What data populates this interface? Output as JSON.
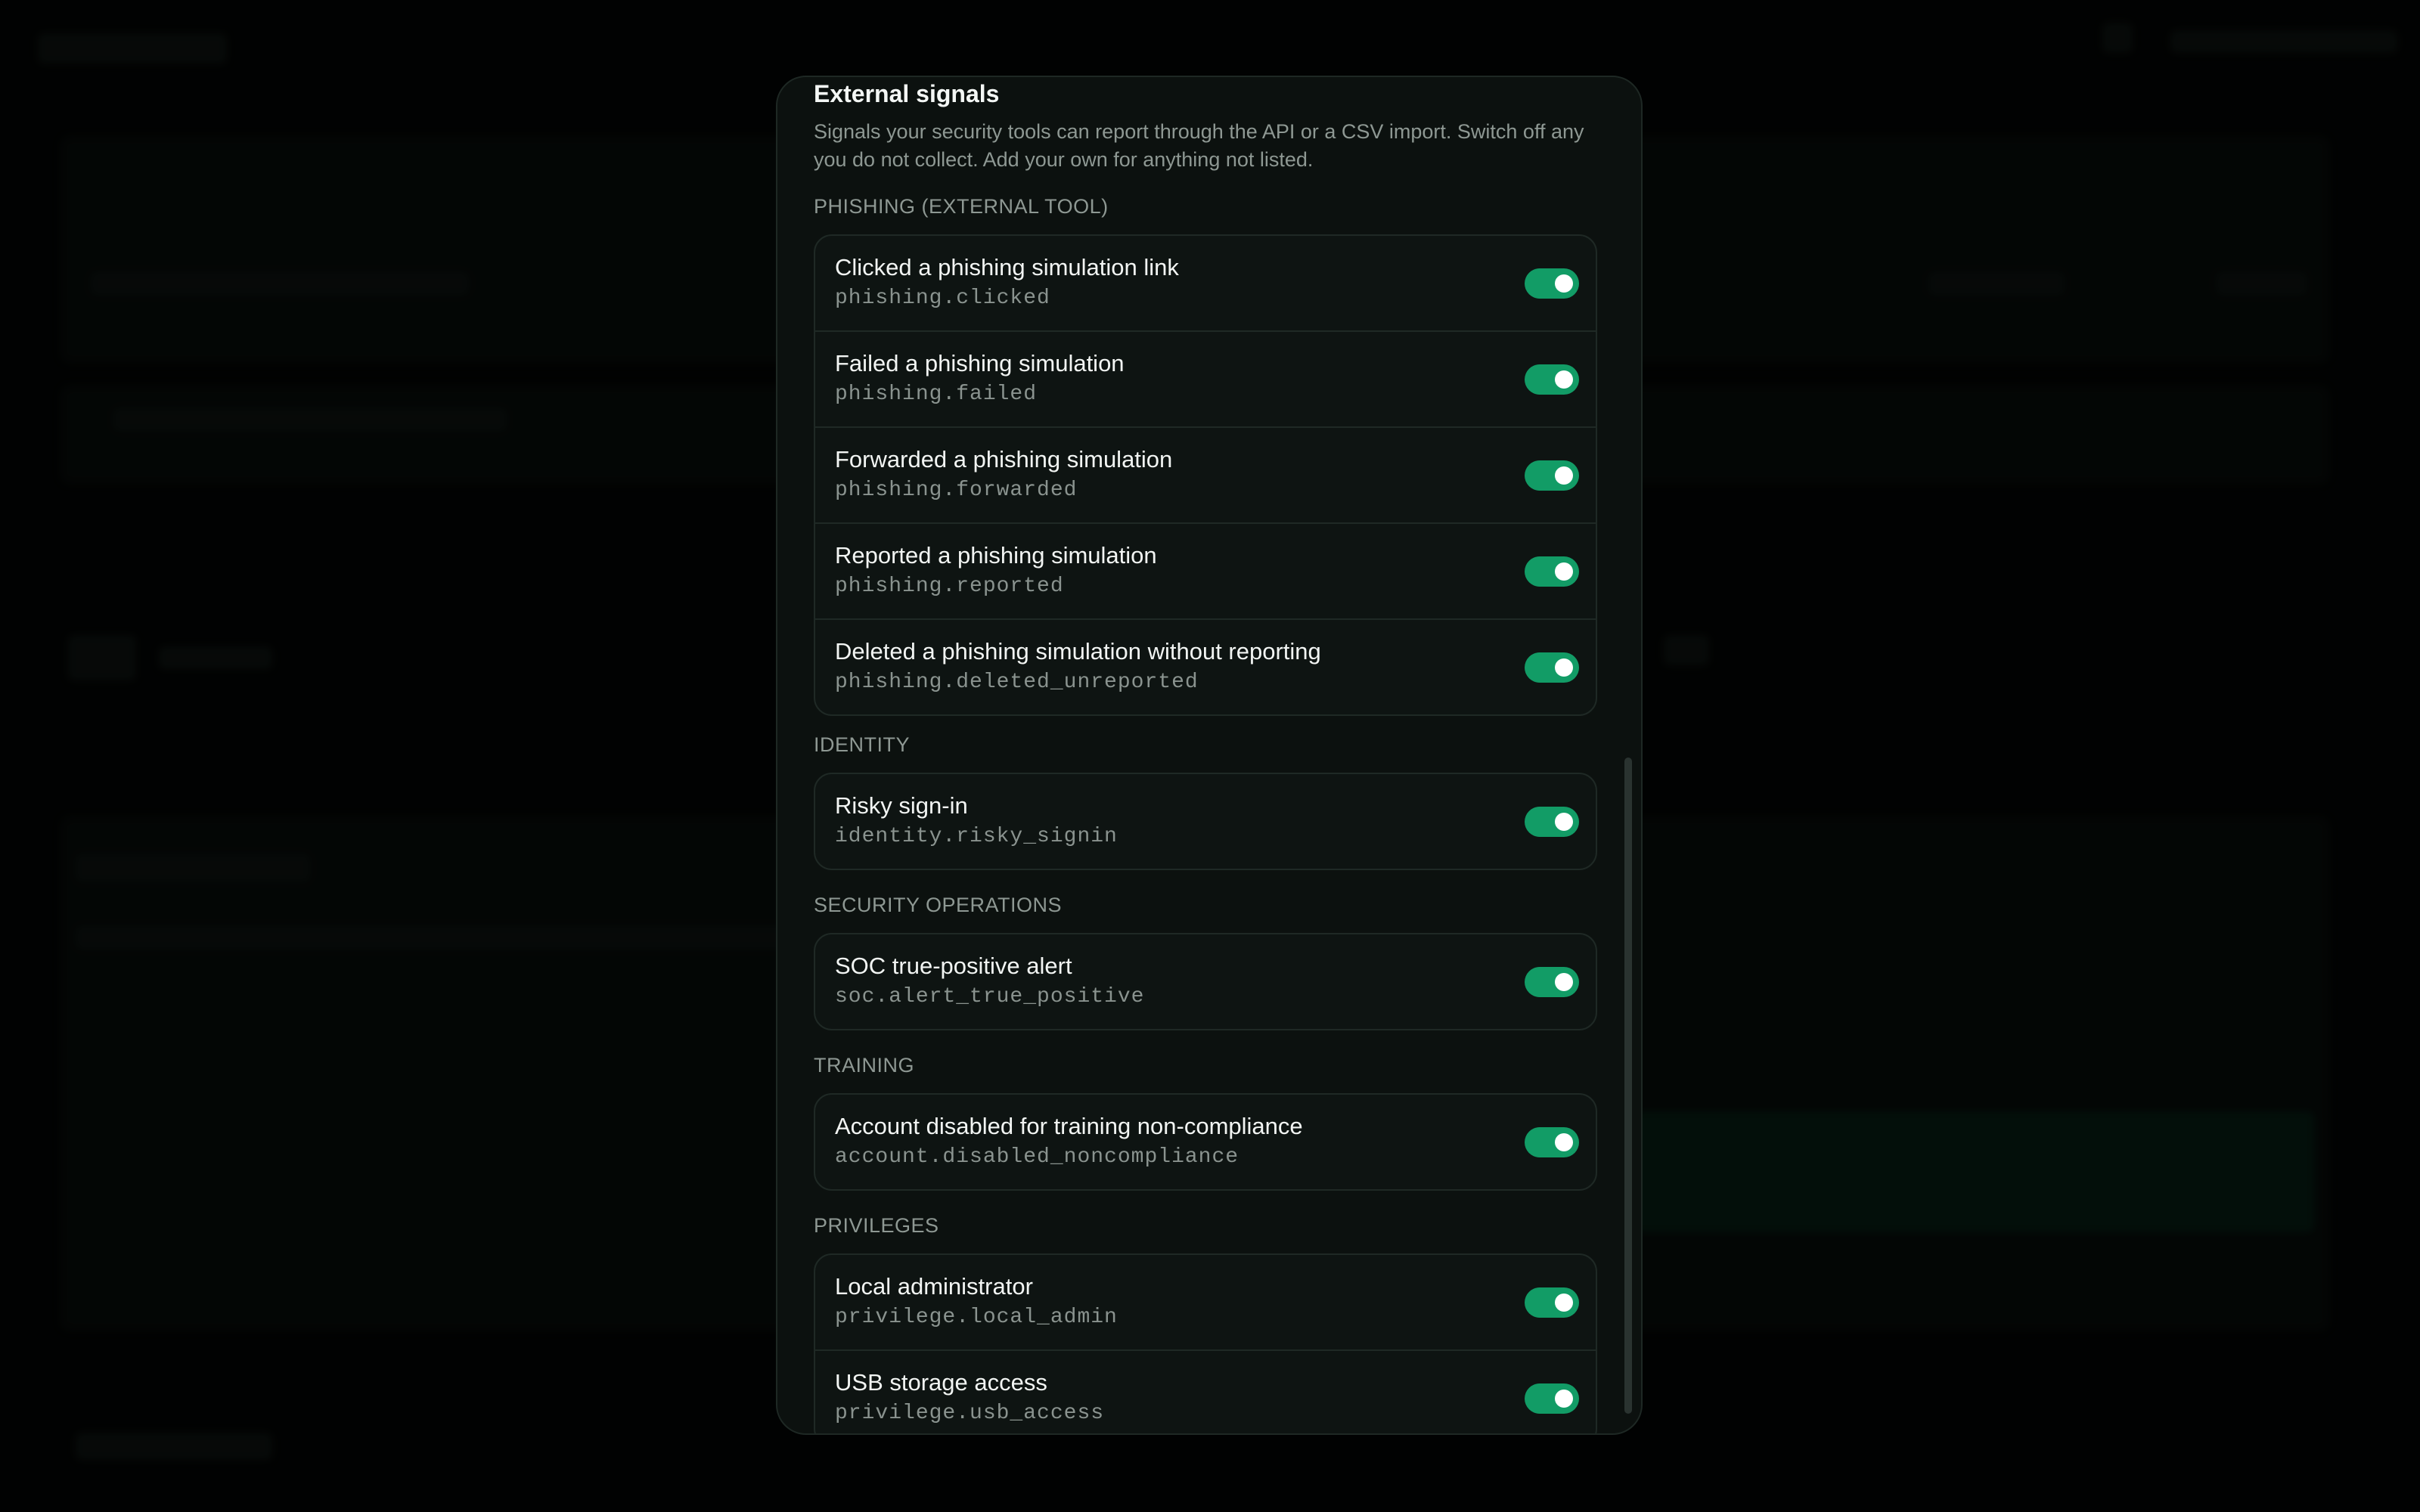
{
  "modal": {
    "section_title": "External signals",
    "section_description": "Signals your security tools can report through the API or a CSV import. Switch off any you do not collect. Add your own for anything not listed.",
    "groups": [
      {
        "heading": "PHISHING (EXTERNAL TOOL)",
        "signals": [
          {
            "label": "Clicked a phishing simulation link",
            "key": "phishing.clicked",
            "enabled": true
          },
          {
            "label": "Failed a phishing simulation",
            "key": "phishing.failed",
            "enabled": true
          },
          {
            "label": "Forwarded a phishing simulation",
            "key": "phishing.forwarded",
            "enabled": true
          },
          {
            "label": "Reported a phishing simulation",
            "key": "phishing.reported",
            "enabled": true
          },
          {
            "label": "Deleted a phishing simulation without reporting",
            "key": "phishing.deleted_unreported",
            "enabled": true
          }
        ]
      },
      {
        "heading": "IDENTITY",
        "signals": [
          {
            "label": "Risky sign-in",
            "key": "identity.risky_signin",
            "enabled": true
          }
        ]
      },
      {
        "heading": "SECURITY OPERATIONS",
        "signals": [
          {
            "label": "SOC true-positive alert",
            "key": "soc.alert_true_positive",
            "enabled": true
          }
        ]
      },
      {
        "heading": "TRAINING",
        "signals": [
          {
            "label": "Account disabled for training non-compliance",
            "key": "account.disabled_noncompliance",
            "enabled": true
          }
        ]
      },
      {
        "heading": "PRIVILEGES",
        "signals": [
          {
            "label": "Local administrator",
            "key": "privilege.local_admin",
            "enabled": true
          },
          {
            "label": "USB storage access",
            "key": "privilege.usb_access",
            "enabled": true
          }
        ]
      }
    ]
  },
  "colors": {
    "accent": "#129c66",
    "modal_bg": "#0c110f",
    "page_bg": "#040605"
  }
}
